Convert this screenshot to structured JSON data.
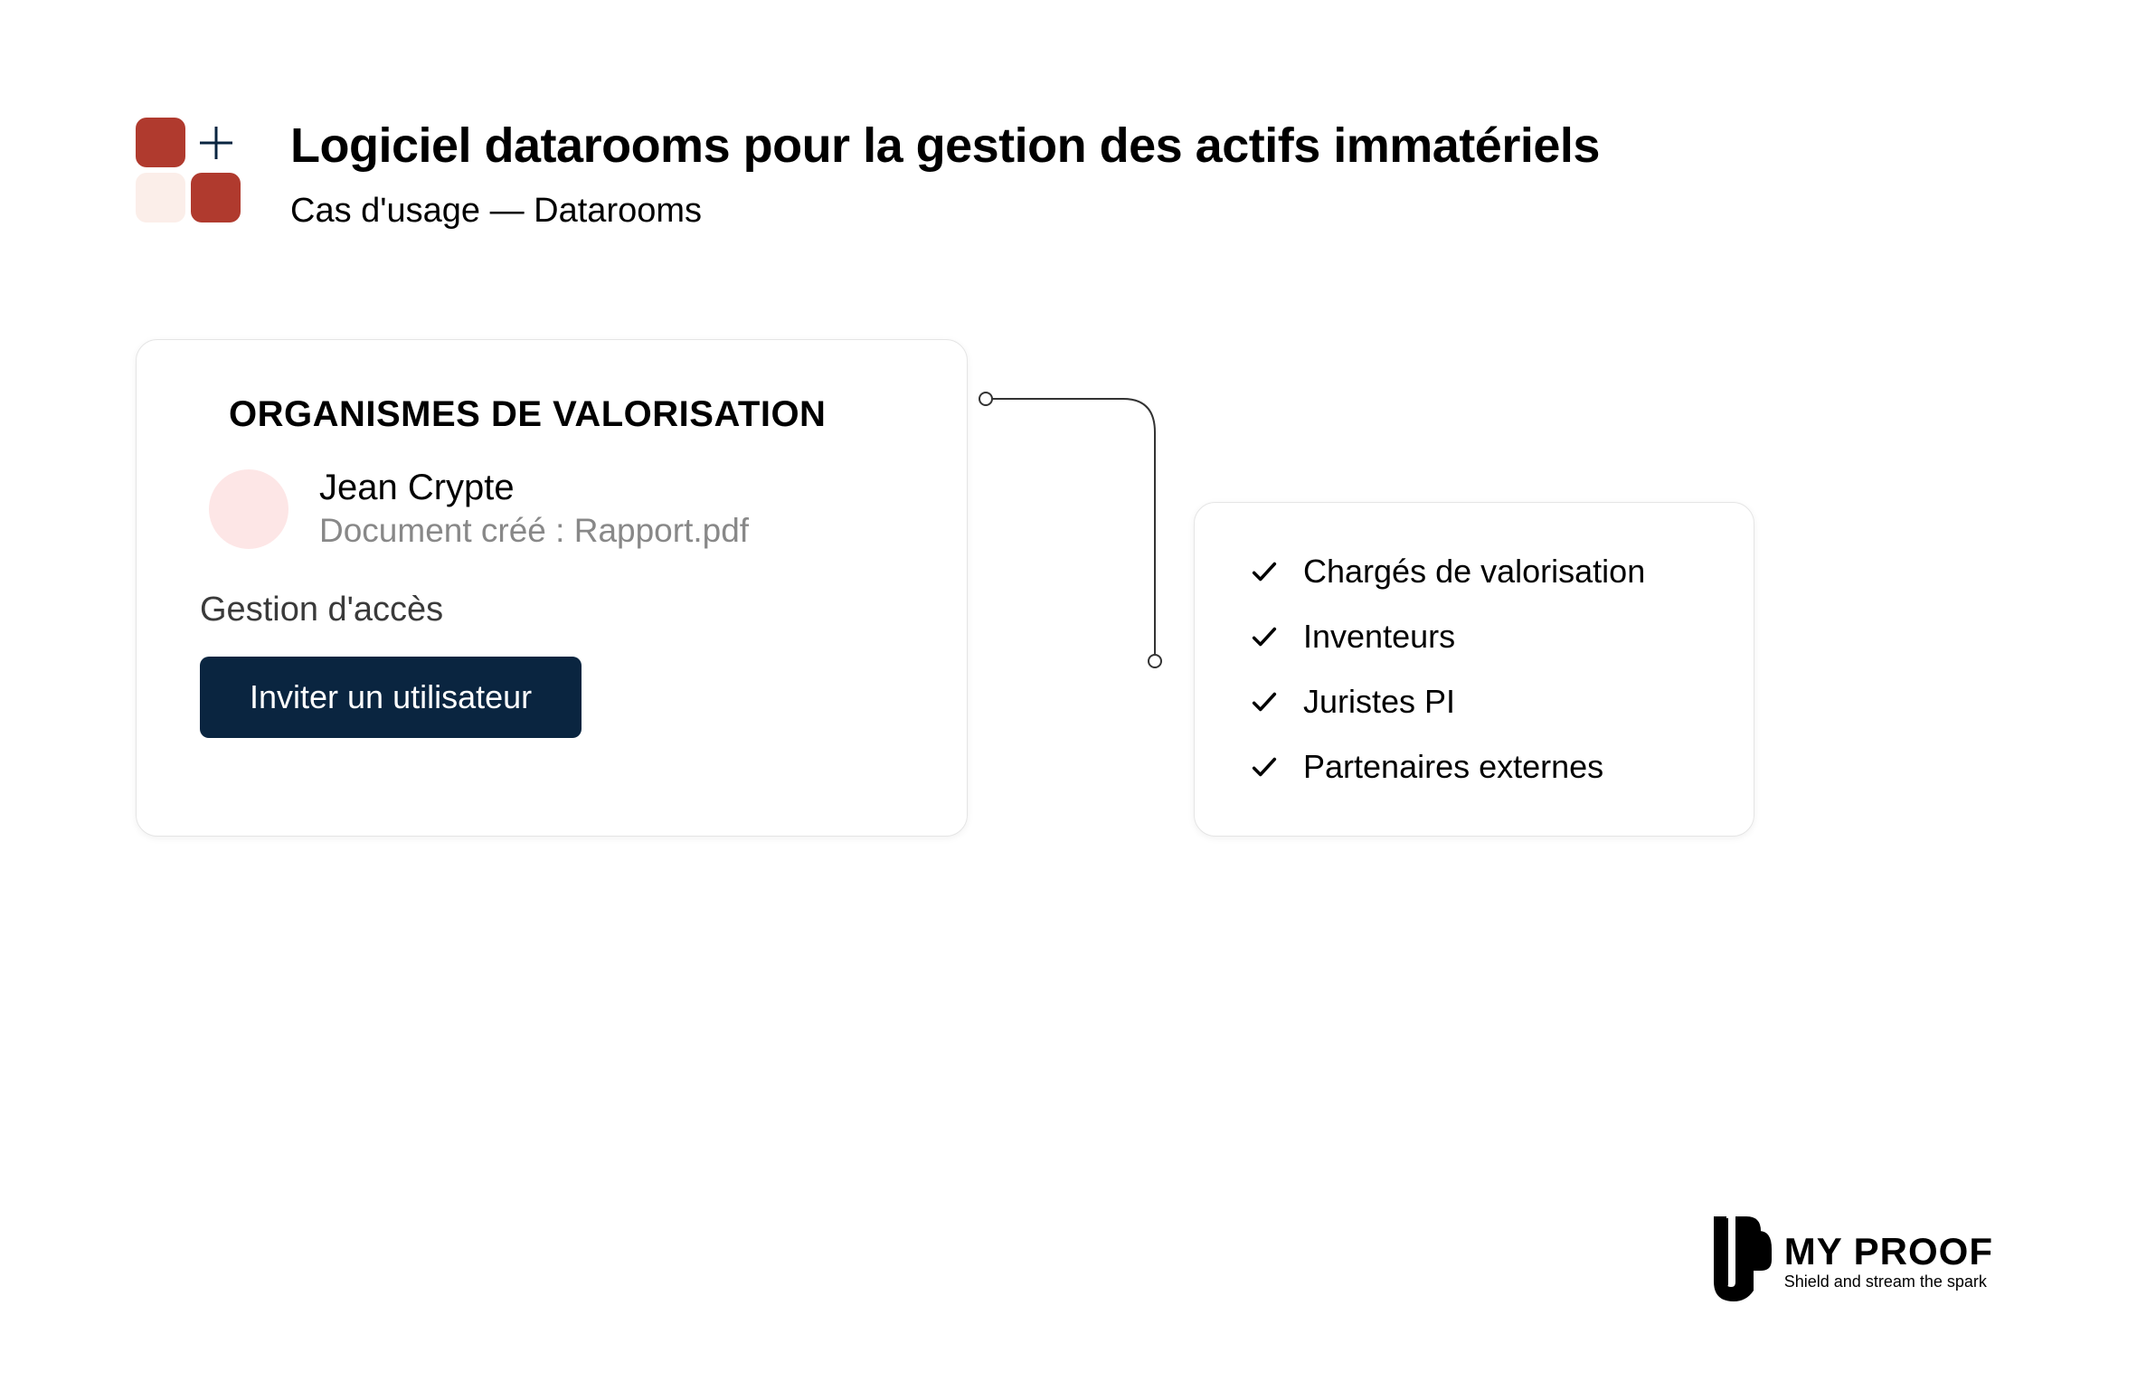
{
  "header": {
    "title": "Logiciel datarooms pour la gestion des actifs immatériels",
    "subtitle": "Cas d'usage — Datarooms"
  },
  "left_card": {
    "title": "ORGANISMES DE VALORISATION",
    "user": {
      "name": "Jean Crypte",
      "document": "Document créé : Rapport.pdf"
    },
    "access_label": "Gestion d'accès",
    "invite_button": "Inviter un utilisateur"
  },
  "right_card": {
    "items": [
      "Chargés de valorisation",
      "Inventeurs",
      "Juristes PI",
      "Partenaires externes"
    ]
  },
  "brand": {
    "name": "MY PROOF",
    "tagline": "Shield and stream the spark"
  }
}
